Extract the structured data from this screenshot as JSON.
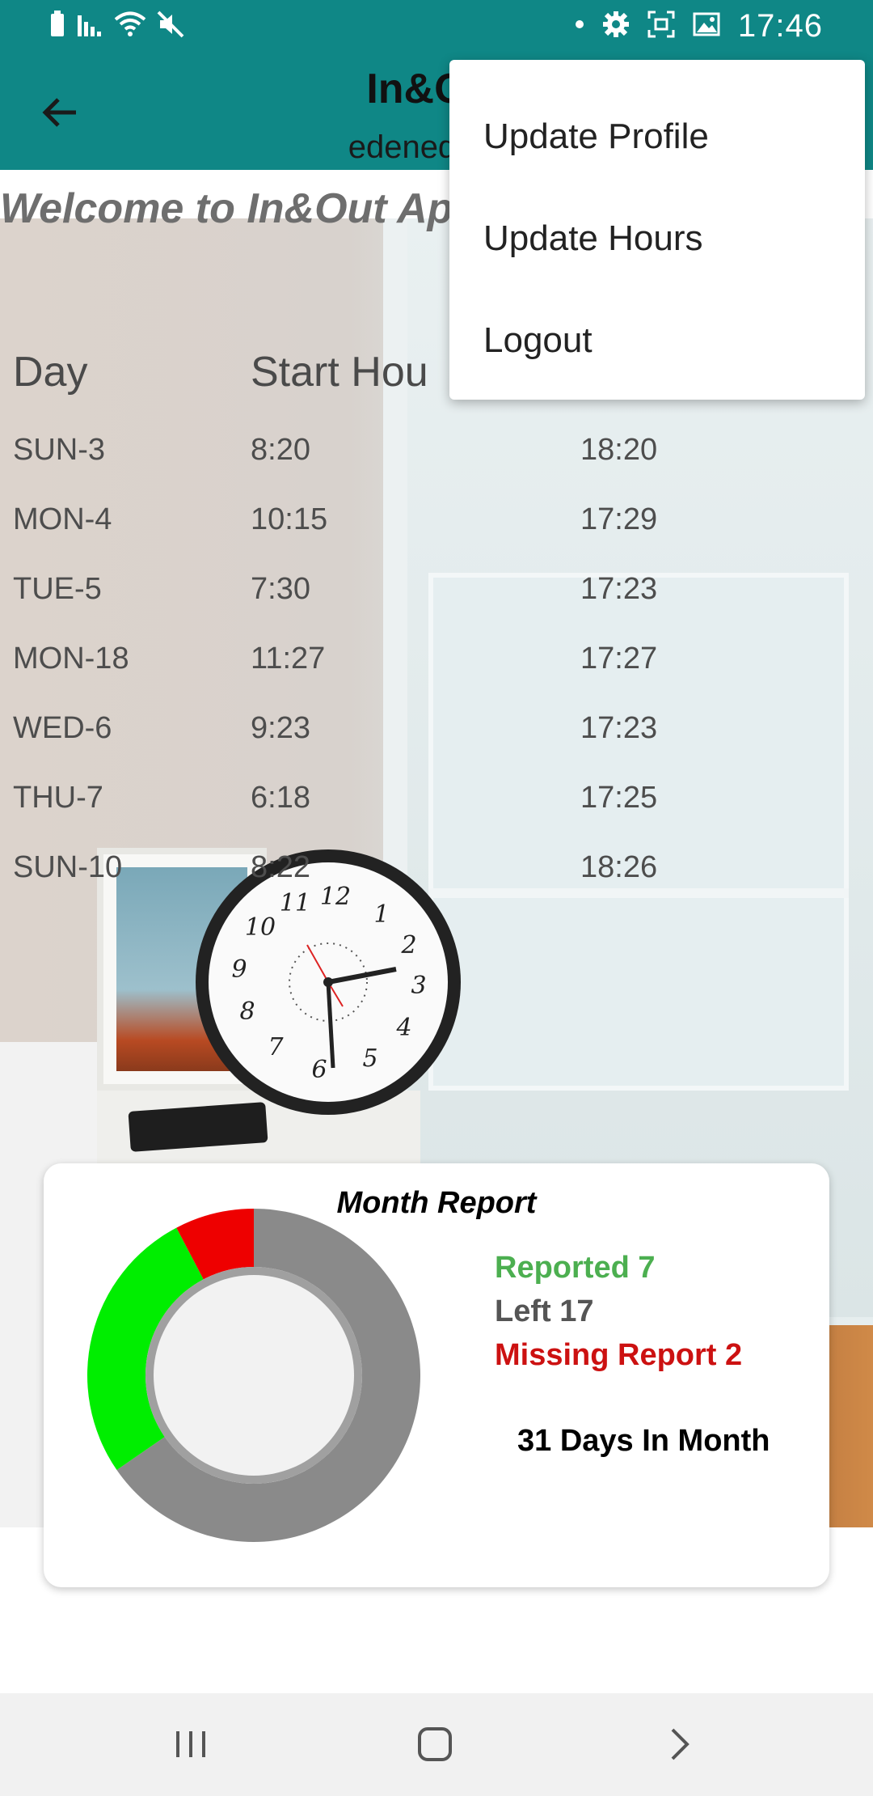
{
  "status_bar": {
    "time": "17:46",
    "icons_left": [
      "battery-icon",
      "signal-icon",
      "wifi-icon",
      "mute-icon"
    ],
    "icons_right": [
      "dot-icon",
      "settings-icon",
      "screenshot-icon",
      "gallery-icon"
    ]
  },
  "app_bar": {
    "title": "In&Out",
    "subtitle": "edeneden@",
    "background_color": "#0f8786"
  },
  "welcome": "Welcome to In&Out Ap",
  "table": {
    "headers": [
      "Day",
      "Start Hou"
    ],
    "rows": [
      {
        "day": "SUN-3",
        "start": "8:20",
        "end": "18:20"
      },
      {
        "day": "MON-4",
        "start": "10:15",
        "end": "17:29"
      },
      {
        "day": "TUE-5",
        "start": "7:30",
        "end": "17:23"
      },
      {
        "day": "MON-18",
        "start": "11:27",
        "end": "17:27"
      },
      {
        "day": "WED-6",
        "start": "9:23",
        "end": "17:23"
      },
      {
        "day": "THU-7",
        "start": "6:18",
        "end": "17:25"
      },
      {
        "day": "SUN-10",
        "start": "8:22",
        "end": "18:26"
      }
    ]
  },
  "menu": {
    "items": [
      "Update Profile",
      "Update Hours",
      "Logout"
    ]
  },
  "report": {
    "title": "Month Report",
    "reported_label": "Reported 7",
    "left_label": "Left 17",
    "missing_label": "Missing Report 2",
    "days_label": "31 Days In Month",
    "colors": {
      "reported": "#00ee00",
      "left": "#8a8a8a",
      "missing": "#ee0000"
    },
    "legend_colors": {
      "reported": "#4caf50",
      "left": "#555555",
      "missing": "#cc1111"
    }
  },
  "chart_data": {
    "type": "pie",
    "title": "Month Report",
    "categories": [
      "Reported",
      "Left",
      "Missing Report"
    ],
    "values": [
      7,
      17,
      2
    ],
    "total_days": 31
  },
  "nav_bar": {
    "buttons": [
      "recents-icon",
      "home-icon",
      "back-chevron-icon"
    ]
  }
}
